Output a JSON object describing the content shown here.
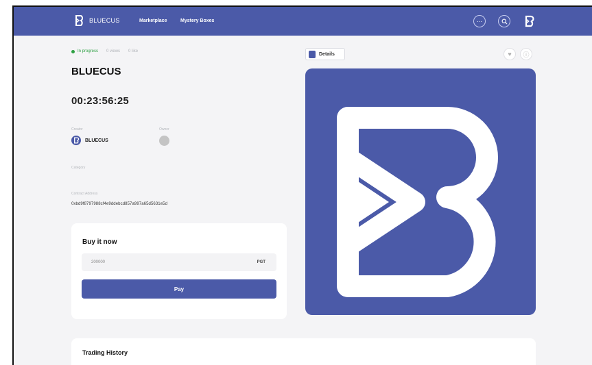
{
  "header": {
    "brand": "BLUECUS",
    "nav": [
      "Marketplace",
      "Mystery Boxes"
    ],
    "more_icon": "more-horizontal-icon",
    "search_icon": "search-icon",
    "profile_icon": "bluecus-logo-icon",
    "color": "#4b5aa8"
  },
  "status": {
    "label": "In progress",
    "views": "0 views",
    "likes": "0 like"
  },
  "item": {
    "title": "BLUECUS",
    "countdown": "00:23:56:25",
    "creator_label": "Creator",
    "creator_name": "BLUECUS",
    "owner_label": "Owner",
    "category_label": "Category",
    "contract_label": "Contract Address",
    "contract_address": "0xbd9f8797988cf4e9ddebcd857a997a65d5631e5d"
  },
  "buy": {
    "title": "Buy it now",
    "price": "200000",
    "unit": "PGT",
    "pay_label": "Pay"
  },
  "details": {
    "tab_label": "Details",
    "like_icon": "heart-icon",
    "info_icon": "info-icon"
  },
  "history": {
    "title": "Trading History"
  }
}
